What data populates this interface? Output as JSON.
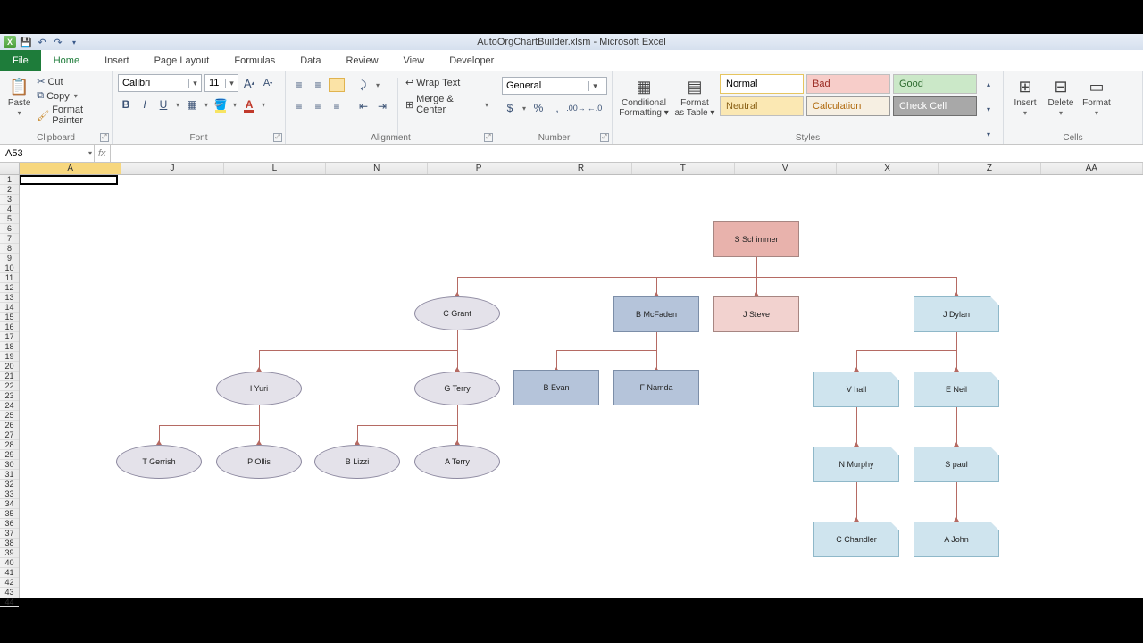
{
  "titlebar": {
    "title": "AutoOrgChartBuilder.xlsm - Microsoft Excel"
  },
  "tabs": [
    "File",
    "Home",
    "Insert",
    "Page Layout",
    "Formulas",
    "Data",
    "Review",
    "View",
    "Developer"
  ],
  "clipboard": {
    "cut": "Cut",
    "copy": "Copy",
    "fp": "Format Painter",
    "paste": "Paste",
    "label": "Clipboard"
  },
  "font": {
    "name": "Calibri",
    "size": "11",
    "label": "Font"
  },
  "alignment": {
    "wrap": "Wrap Text",
    "merge": "Merge & Center",
    "label": "Alignment"
  },
  "number": {
    "fmt": "General",
    "label": "Number"
  },
  "styles": {
    "cond": "Conditional",
    "cond2": "Formatting",
    "fmt": "Format",
    "fmt2": "as Table",
    "cells": [
      "Normal",
      "Bad",
      "Good",
      "Neutral",
      "Calculation",
      "Check Cell"
    ],
    "label": "Styles"
  },
  "cells": {
    "insert": "Insert",
    "delete": "Delete",
    "format": "Format",
    "label": "Cells"
  },
  "fx": {
    "namebox": "A53",
    "fx": "fx"
  },
  "cols": [
    "A",
    "J",
    "L",
    "N",
    "P",
    "R",
    "T",
    "V",
    "X",
    "Z",
    "AA"
  ],
  "rows": 44,
  "chart_data": {
    "type": "tree",
    "root": "S Schimmer",
    "nodes": {
      "S Schimmer": {
        "children": [
          "C Grant",
          "B McFaden",
          "J Steve",
          "J Dylan"
        ],
        "style": "pink-rect"
      },
      "C Grant": {
        "children": [
          "I Yuri",
          "G Terry"
        ],
        "style": "oval"
      },
      "I Yuri": {
        "children": [
          "T Gerrish",
          "P Ollis"
        ],
        "style": "oval"
      },
      "G Terry": {
        "children": [
          "B Lizzi",
          "A Terry"
        ],
        "style": "oval"
      },
      "T Gerrish": {
        "children": [],
        "style": "oval"
      },
      "P Ollis": {
        "children": [],
        "style": "oval"
      },
      "B Lizzi": {
        "children": [],
        "style": "oval"
      },
      "A Terry": {
        "children": [],
        "style": "oval"
      },
      "B McFaden": {
        "children": [
          "B Evan",
          "F Namda"
        ],
        "style": "blue-rect"
      },
      "B Evan": {
        "children": [],
        "style": "blue-rect"
      },
      "F Namda": {
        "children": [],
        "style": "blue-rect"
      },
      "J Steve": {
        "children": [],
        "style": "lpink-rect"
      },
      "J Dylan": {
        "children": [
          "V hall",
          "E Neil"
        ],
        "style": "lblue-cut"
      },
      "V hall": {
        "children": [
          "N Murphy"
        ],
        "style": "lblue-cut"
      },
      "E Neil": {
        "children": [
          "S paul"
        ],
        "style": "lblue-cut"
      },
      "N Murphy": {
        "children": [
          "C Chandler"
        ],
        "style": "lblue-cut"
      },
      "S paul": {
        "children": [
          "A John"
        ],
        "style": "lblue-cut"
      },
      "C Chandler": {
        "children": [],
        "style": "lblue-cut"
      },
      "A John": {
        "children": [],
        "style": "lblue-cut"
      }
    }
  },
  "org": {
    "n1": "S Schimmer",
    "n2": "C Grant",
    "n3": "B McFaden",
    "n4": "J Steve",
    "n5": "J Dylan",
    "n6": "I Yuri",
    "n7": "G Terry",
    "n8": "B Evan",
    "n9": "F Namda",
    "n10": "V hall",
    "n11": "E Neil",
    "n12": "T Gerrish",
    "n13": "P Ollis",
    "n14": "B Lizzi",
    "n15": "A Terry",
    "n16": "N Murphy",
    "n17": "S paul",
    "n18": "C Chandler",
    "n19": "A John"
  }
}
